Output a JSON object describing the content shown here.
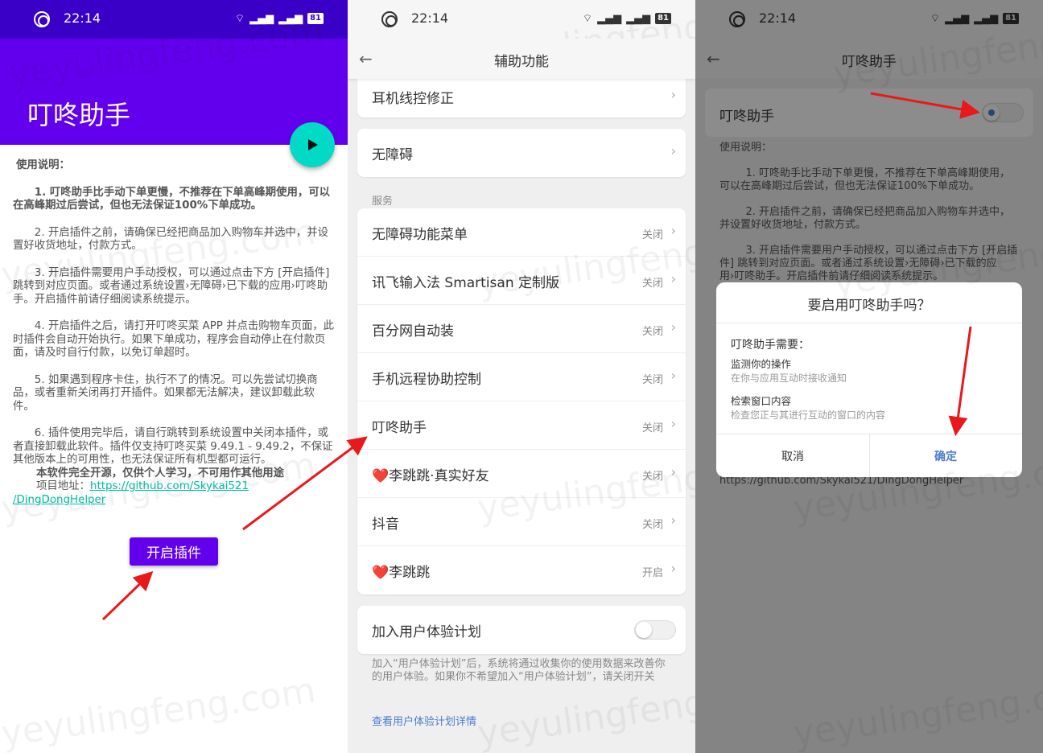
{
  "status": {
    "time": "22:14",
    "battery": "81",
    "wifi_glyph": "⌔",
    "signal_glyph": "▂▄▆"
  },
  "screen1": {
    "title": "叮咚助手",
    "doc_heading": "使用说明：",
    "para1": "1. 叮咚助手比手动下单更慢，不推荐在下单高峰期使用，可以在高峰期过后尝试，但也无法保证100%下单成功。",
    "para2": "2. 开启插件之前，请确保已经把商品加入购物车并选中，并设置好收货地址，付款方式。",
    "para3": "3. 开启插件需要用户手动授权，可以通过点击下方 [开启插件] 跳转到对应页面。或者通过系统设置›无障碍›已下载的应用›叮咚助手。开启插件前请仔细阅读系统提示。",
    "para4": "4. 开启插件之后，请打开叮咚买菜 APP 并点击购物车页面，此时插件会自动开始执行。如果下单成功，程序会自动停止在付款页面，请及时自行付款，以免订单超时。",
    "para5": "5. 如果遇到程序卡住，执行不了的情况。可以先尝试切换商品，或者重新关闭再打开插件。如果都无法解决，建议卸载此软件。",
    "para6": "6. 插件使用完毕后，请自行跳转到系统设置中关闭本插件，或者直接卸载此软件。插件仅支持叮咚买菜 9.49.1 - 9.49.2，不保证其他版本上的可用性，也无法保证所有机型都可运行。",
    "open_source": "本软件完全开源，仅供个人学习，不可用作其他用途",
    "project_label": "项目地址：",
    "project_link_1": "https://github.com/Skykai521",
    "project_link_2": "/DingDongHelper",
    "start_button": "开启插件"
  },
  "screen2": {
    "title": "辅助功能",
    "earphone": "耳机线控修正",
    "accessibility": "无障碍",
    "section": "服务",
    "services": [
      {
        "label": "无障碍功能菜单",
        "status": "关闭"
      },
      {
        "label": "讯飞输入法 Smartisan 定制版",
        "status": "关闭"
      },
      {
        "label": "百分网自动装",
        "status": "关闭"
      },
      {
        "label": "手机远程协助控制",
        "status": "关闭"
      },
      {
        "label": "叮咚助手",
        "status": "关闭"
      },
      {
        "label": "❤️李跳跳·真实好友",
        "status": "关闭"
      },
      {
        "label": "抖音",
        "status": "关闭"
      },
      {
        "label": "❤️李跳跳",
        "status": "开启"
      }
    ],
    "ux_plan": "加入用户体验计划",
    "ux_note": "加入“用户体验计划”后，系统将通过收集你的使用数据来改善你的用户体验。如果你不希望加入“用户体验计划”，请关闭开关",
    "ux_link": "查看用户体验计划详情"
  },
  "screen3": {
    "title": "叮咚助手",
    "switch_label": "叮咚助手",
    "doc_heading": "使用说明：",
    "para1": "1. 叮咚助手比手动下单更慢，不推荐在下单高峰期使用，可以在高峰期过后尝试，但也无法保证100%下单成功。",
    "para2": "2. 开启插件之前，请确保已经把商品加入购物车并选中，并设置好收货地址，付款方式。",
    "para3": "3. 开启插件需要用户手动授权，可以通过点击下方 [开启插件] 跳转到对应页面。或者通过系统设置›无障碍›已下载的应用›叮咚助手。开启插件前请仔细阅读系统提示。",
    "link_text": "https://github.com/Skykai521/DingDongHelper",
    "dialog": {
      "title": "要启用叮咚助手吗？",
      "needs": "叮咚助手需要：",
      "perm1_title": "监测你的操作",
      "perm1_desc": "在你与应用互动时接收通知",
      "perm2_title": "检索窗口内容",
      "perm2_desc": "检查您正与其进行互动的窗口的内容",
      "cancel": "取消",
      "confirm": "确定"
    }
  },
  "watermark": "yeyulingfeng.com",
  "colors": {
    "primary": "#6200ee",
    "accent": "#03dac5",
    "link_blue": "#4a7ccc",
    "arrow": "#e8191c"
  }
}
